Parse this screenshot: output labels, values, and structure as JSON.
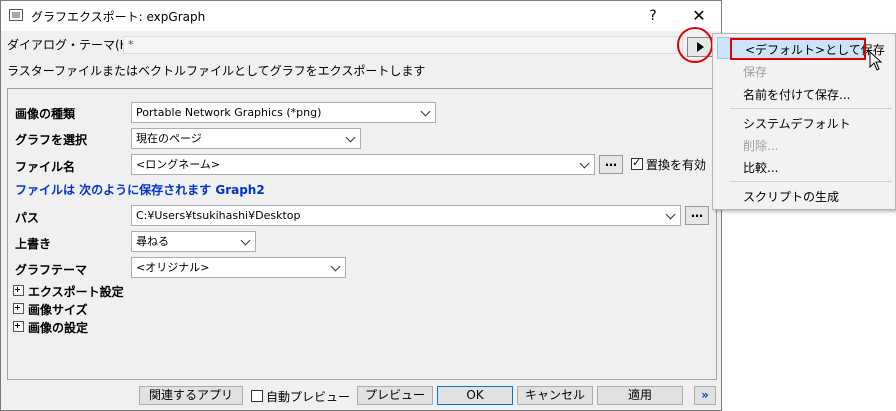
{
  "window": {
    "title": "グラフエクスポート: expGraph",
    "help": "?",
    "close": "✕"
  },
  "theme": {
    "label": "ダイアログ・テーマ(H)",
    "value": "*"
  },
  "description": "ラスターファイルまたはベクトルファイルとしてグラフをエクスポートします",
  "form": {
    "image_type_label": "画像の種類",
    "image_type_value": "Portable Network Graphics (*png)",
    "select_graph_label": "グラフを選択",
    "select_graph_value": "現在のページ",
    "filename_label": "ファイル名",
    "filename_value": "<ロングネーム>",
    "replace_label": "置換を有効",
    "replace_checked": true,
    "save_note": "ファイルは 次のように保存されます Graph2",
    "path_label": "パス",
    "path_value": "C:¥Users¥tsukihashi¥Desktop",
    "overwrite_label": "上書き",
    "overwrite_value": "尋ねる",
    "graph_theme_label": "グラフテーマ",
    "graph_theme_value": "<オリジナル>",
    "dots": "…"
  },
  "sections": [
    "エクスポート設定",
    "画像サイズ",
    "画像の設定"
  ],
  "buttons": {
    "related_apps": "関連するアプリ",
    "auto_preview": "自動プレビュー",
    "preview": "プレビュー",
    "ok": "OK",
    "cancel": "キャンセル",
    "apply": "適用",
    "more": "»"
  },
  "menu": {
    "save_default": "<デフォルト>として保存",
    "save": "保存",
    "save_as": "名前を付けて保存...",
    "system_default": "システムデフォルト",
    "delete": "削除...",
    "compare": "比較...",
    "generate_script": "スクリプトの生成"
  },
  "colors": {
    "highlight_red": "#e00000",
    "link_blue": "#0033cc"
  }
}
